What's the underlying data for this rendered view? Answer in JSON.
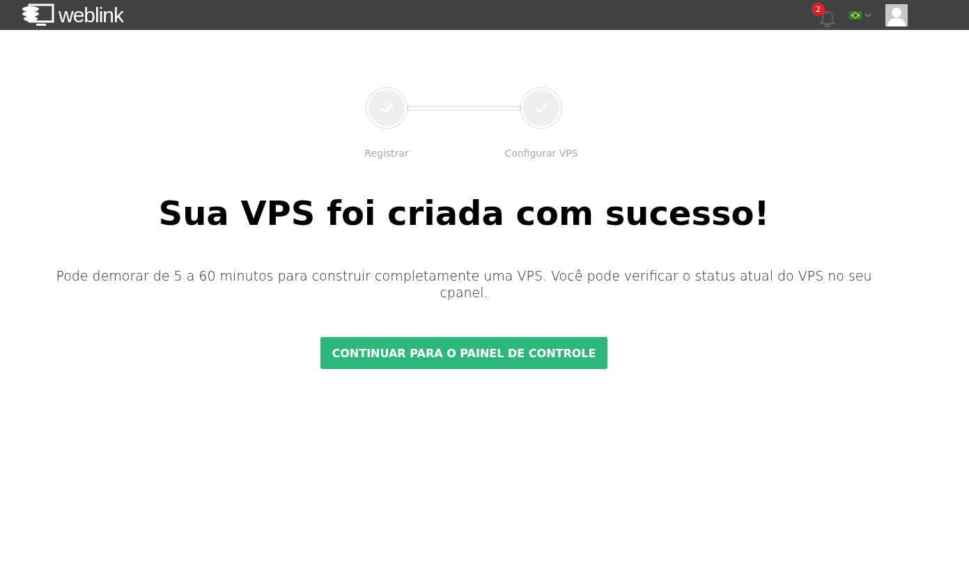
{
  "header": {
    "brand": "weblink",
    "notifications": {
      "count": "2"
    }
  },
  "steps": [
    {
      "label": "Registrar",
      "done": true
    },
    {
      "label": "Configurar VPS",
      "done": true
    }
  ],
  "title": "Sua VPS foi criada com sucesso!",
  "message": "Pode demorar de 5 a 60 minutos para construir completamente uma VPS. Você pode verificar o status atual do VPS no seu cpanel.",
  "button": "CONTINUAR PARA O PAINEL DE CONTROLE"
}
